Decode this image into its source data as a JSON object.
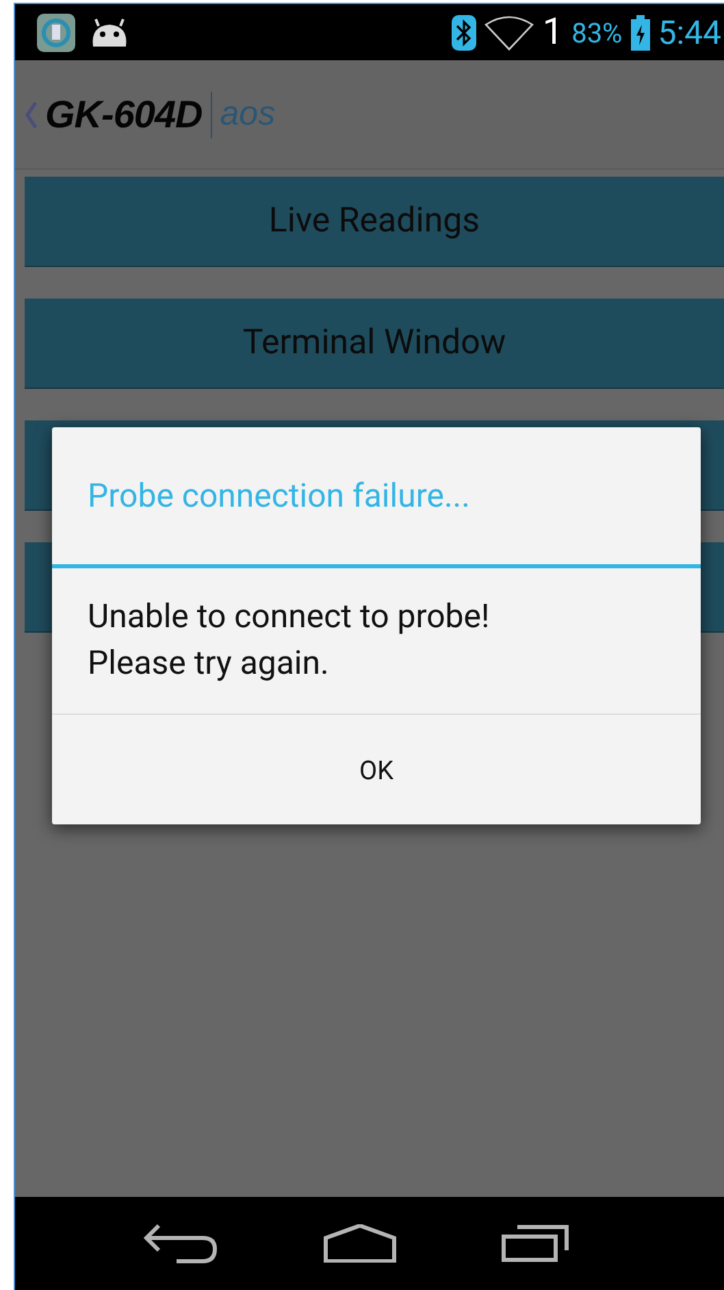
{
  "status_bar": {
    "signal_label": "1",
    "battery": "83%",
    "time": "5:44"
  },
  "action_bar": {
    "title": "GK-604D",
    "subtitle": "aos"
  },
  "menu_buttons": [
    {
      "kind": "labeled",
      "label": "Live Readings"
    },
    {
      "kind": "labeled",
      "label": "Terminal Window"
    },
    {
      "kind": "covered"
    },
    {
      "kind": "covered"
    }
  ],
  "dialog": {
    "title": "Probe connection failure...",
    "message": "Unable to connect to probe!\nPlease try again.",
    "buttons": [
      "OK"
    ]
  }
}
